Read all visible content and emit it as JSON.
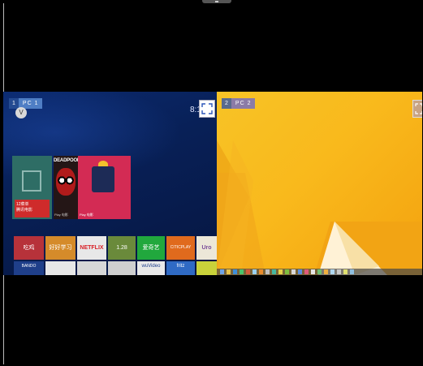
{
  "screens": {
    "left": {
      "badge_number": "1",
      "badge_name": "PC 1",
      "avatar_text": "V",
      "clock_text": "8:1",
      "tiles": {
        "movie_label": "12菜单",
        "movie_sublabel": "腾讯电影",
        "deadpool_title": "DEADPOOL",
        "deadpool_sub": "Play 电影",
        "gift_sub": "Play 电影"
      },
      "apps_row1": [
        "吃鸡",
        "好好学习",
        "NETFLIX",
        "1.28",
        "爱奇艺",
        "CITICPLAY",
        "Uro"
      ],
      "apps_row2": [
        "BANDO",
        "",
        "",
        "",
        "wuVideo",
        "fritz",
        ""
      ]
    },
    "right": {
      "badge_number": "2",
      "badge_name": "PC 2"
    }
  },
  "colors": {
    "left_bg": "#082057",
    "right_bg": "#f7b91e",
    "accent_red": "#cf2b2b"
  },
  "icons": [
    "expand-icon",
    "film-icon",
    "avatar-icon"
  ]
}
